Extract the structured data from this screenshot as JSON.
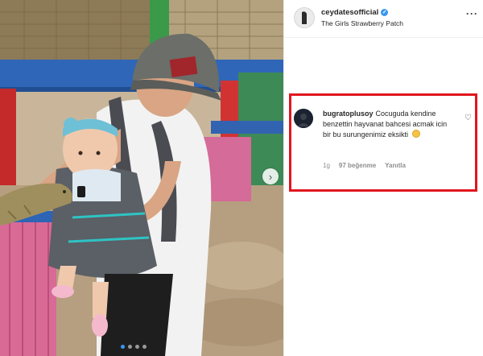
{
  "post": {
    "owner": "ceydatesofficial",
    "location": "The Girls Strawberry Patch",
    "more_icon": "more-horizontal-icon",
    "verified_icon": "verified-badge-icon",
    "next_icon": "chevron-right-icon",
    "carousel": {
      "total": 4,
      "active": 0
    }
  },
  "comment": {
    "username": "bugratoplusoy",
    "text": "Cocuguda kendine benzettin hayvanat bahcesi acmak icin bir bu surungenimiz eksikti",
    "emoji": "😂",
    "age": "1g",
    "likes": "97 beğenme",
    "reply": "Yanıtla",
    "like_icon": "heart-outline-icon"
  },
  "colors": {
    "highlight": "#e0161e",
    "verified": "#3897f0",
    "text": "#262626",
    "muted": "#8e8e8e"
  }
}
